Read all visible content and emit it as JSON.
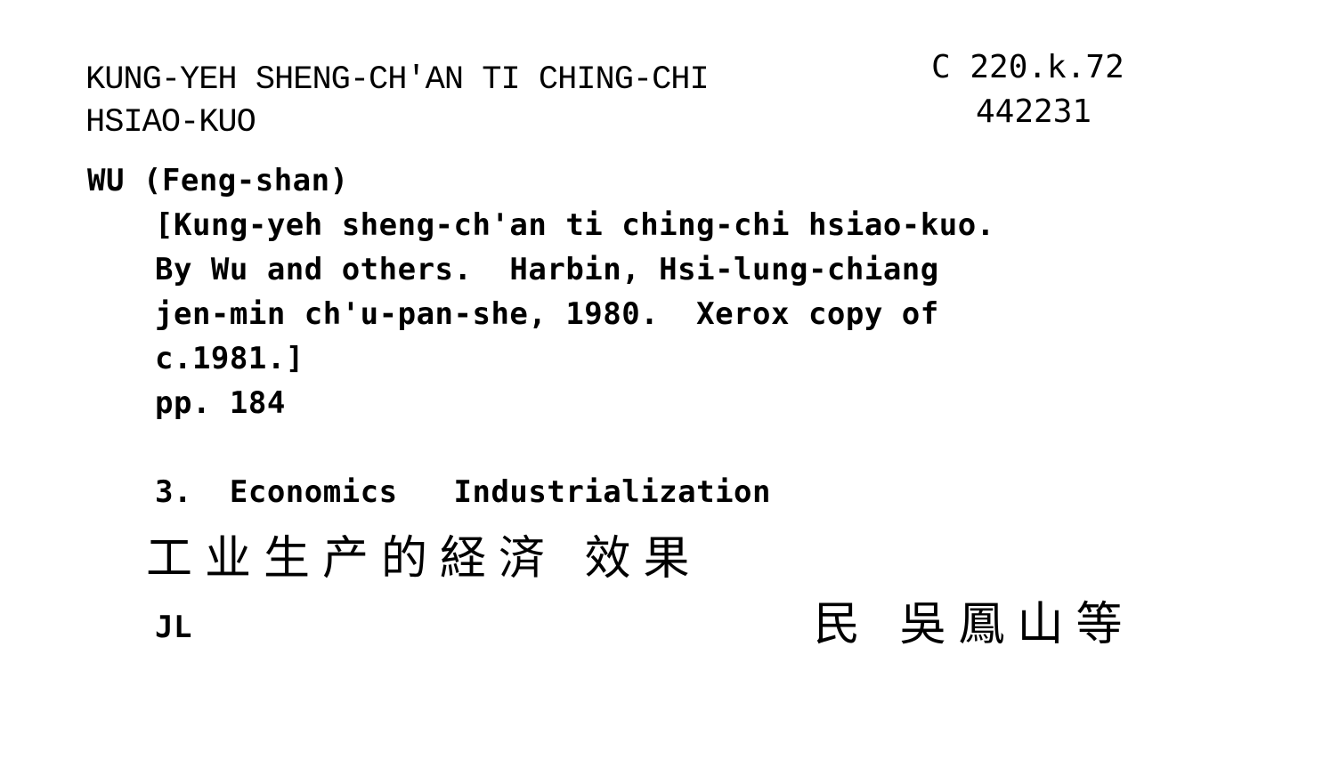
{
  "card": {
    "title_line1": "KUNG-YEH SHENG-CH'AN TI CHING-CHI",
    "title_line2": "HSIAO-KUO",
    "shelfmark": "C 220.k.72",
    "accession": "442231",
    "author": "WU (Feng-shan)",
    "body_lines": [
      "[Kung-yeh sheng-ch'an ti ching-chi hsiao-kuo.",
      "By Wu and others.  Harbin, Hsi-lung-chiang",
      "jen-min ch'u-pan-she, 1980.  Xerox copy of",
      "c.1981.]"
    ],
    "pages": "pp. 184",
    "subject": "3.  Economics   Industrialization",
    "chinese_title": "工业生产的経済 效果",
    "initials": "JL",
    "chinese_author": "民 吳鳳山等"
  }
}
